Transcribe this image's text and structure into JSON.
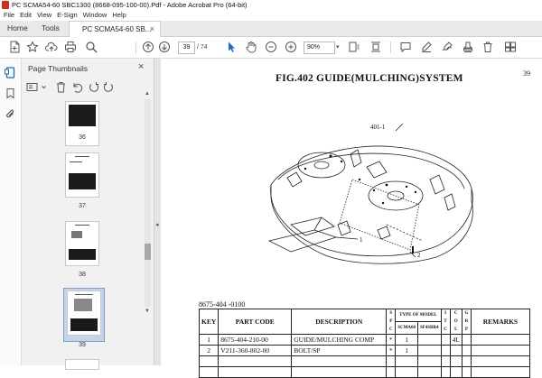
{
  "window": {
    "title": "PC SCMA54-60 SBC1300 (8668-095-100-00).Pdf - Adobe Acrobat Pro (64-bit)"
  },
  "menu": [
    "File",
    "Edit",
    "View",
    "E-Sign",
    "Window",
    "Help"
  ],
  "tabs": {
    "home": "Home",
    "tools": "Tools",
    "document": "PC SCMA54-60 SB...",
    "close": "×"
  },
  "toolbar": {
    "current_page": "39",
    "total_pages": "/ 74",
    "zoom": "90%"
  },
  "thumbnails_panel": {
    "title": "Page Thumbnails",
    "close": "×",
    "pages": [
      "36",
      "37",
      "38",
      "39"
    ],
    "selected_page": "39"
  },
  "document": {
    "figure_title": "FIG.402  GUIDE(MULCHING)SYSTEM",
    "page_number": "39",
    "callouts": [
      "401-1",
      "1",
      "2"
    ],
    "part_ref": "8675-404 -0100",
    "table": {
      "headers": {
        "key": "KEY",
        "part_code": "PART CODE",
        "description": "DESCRIPTION",
        "spc": "S P C",
        "type_of_model": "TYPE OF MODEL",
        "model_a": "SCMA60",
        "model_b": "SF4SBR4",
        "itc": "I T C",
        "col": "C O L",
        "grp": "G R P",
        "remarks": "REMARKS"
      },
      "rows": [
        {
          "key": "1",
          "part_code": "8675-404-210-00",
          "description": "GUIDE/MULCHING  COMP",
          "spc": "*",
          "qty": "1",
          "col": "4L",
          "remarks": ""
        },
        {
          "key": "2",
          "part_code": "V211-360-802-00",
          "description": "BOLT/SP",
          "spc": "*",
          "qty": "1",
          "col": "",
          "remarks": ""
        }
      ]
    }
  }
}
